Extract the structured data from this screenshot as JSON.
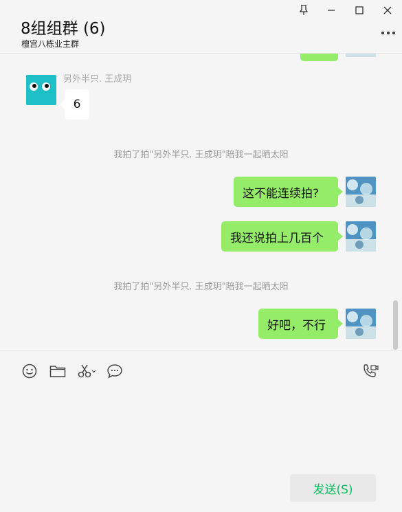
{
  "header": {
    "title": "8组组群 (6)",
    "subtitle": "檀宫八栋业主群"
  },
  "icons": {
    "pin": "pin-icon",
    "minimize": "minimize-icon",
    "maximize": "maximize-icon",
    "close": "close-icon",
    "more": "more-icon"
  },
  "chat": {
    "other_message": {
      "sender": "另外半只. 王成玥",
      "text": "6"
    },
    "system_messages": [
      "我拍了拍\"另外半只. 王成玥\"陪我一起晒太阳",
      "我拍了拍\"另外半只. 王成玥\"陪我一起晒太阳"
    ],
    "my_messages": [
      "这不能连续拍?",
      "我还说拍上几百个",
      "好吧，不行"
    ]
  },
  "toolbar": {
    "tools": [
      "emoji-icon",
      "folder-icon",
      "scissors-icon",
      "chat-bubble-icon",
      "video-call-icon"
    ]
  },
  "send": {
    "label": "发送(S)"
  },
  "colors": {
    "my_bubble": "#95ec69",
    "send_text": "#07c160",
    "background": "#f5f5f5"
  }
}
